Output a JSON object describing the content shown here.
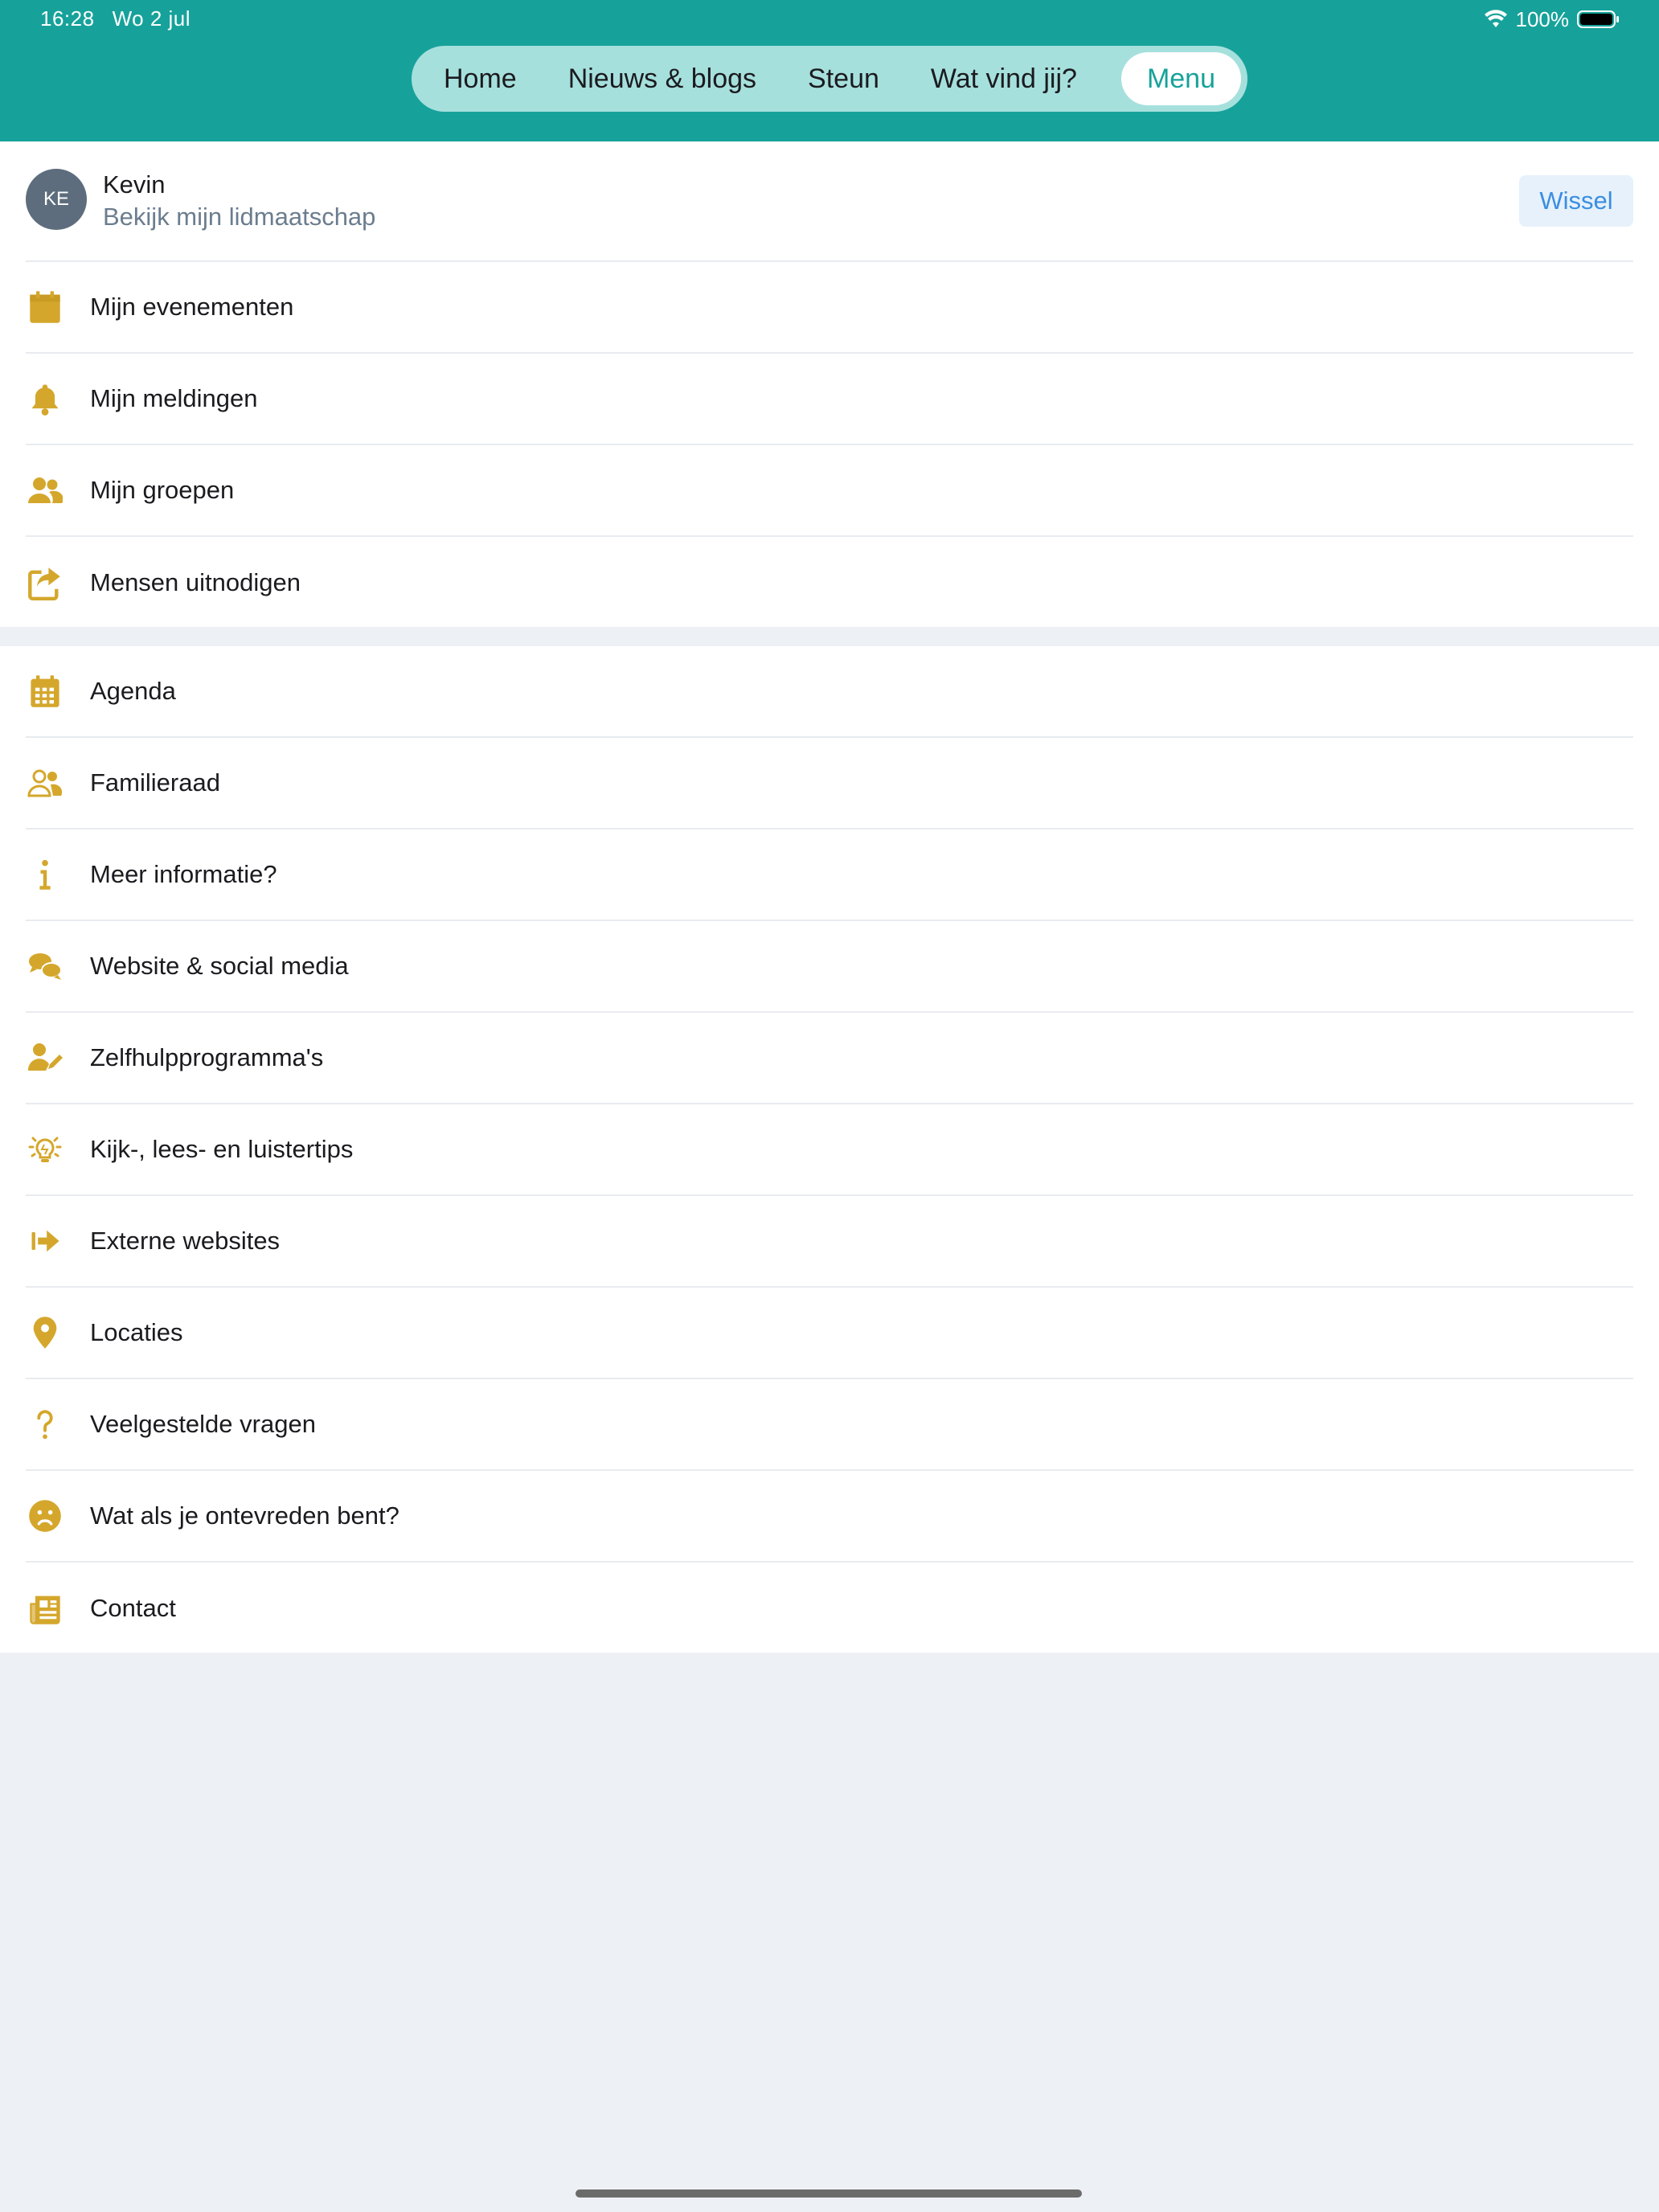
{
  "status_bar": {
    "time": "16:28",
    "date": "Wo 2 jul",
    "battery": "100%"
  },
  "nav": {
    "tabs": [
      {
        "label": "Home"
      },
      {
        "label": "Nieuws & blogs"
      },
      {
        "label": "Steun"
      },
      {
        "label": "Wat vind jij?"
      },
      {
        "label": "Menu"
      }
    ],
    "active": "Menu"
  },
  "profile": {
    "initials": "KE",
    "name": "Kevin",
    "subtitle": "Bekijk mijn lidmaatschap",
    "switch_label": "Wissel"
  },
  "personal_menu": [
    {
      "label": "Mijn evenementen",
      "icon": "calendar-icon"
    },
    {
      "label": "Mijn meldingen",
      "icon": "bell-icon"
    },
    {
      "label": "Mijn groepen",
      "icon": "users-icon"
    },
    {
      "label": "Mensen uitnodigen",
      "icon": "share-icon"
    }
  ],
  "main_menu": [
    {
      "label": "Agenda",
      "icon": "calendar-grid-icon"
    },
    {
      "label": "Familieraad",
      "icon": "user-group-icon"
    },
    {
      "label": "Meer informatie?",
      "icon": "info-icon"
    },
    {
      "label": "Website & social media",
      "icon": "comments-icon"
    },
    {
      "label": "Zelfhulpprogramma's",
      "icon": "user-pen-icon"
    },
    {
      "label": "Kijk-, lees- en luistertips",
      "icon": "lightbulb-icon"
    },
    {
      "label": "Externe websites",
      "icon": "external-arrow-icon"
    },
    {
      "label": "Locaties",
      "icon": "location-pin-icon"
    },
    {
      "label": "Veelgestelde vragen",
      "icon": "question-icon"
    },
    {
      "label": "Wat als je ontevreden bent?",
      "icon": "sad-face-icon"
    },
    {
      "label": "Contact",
      "icon": "newspaper-icon"
    }
  ],
  "colors": {
    "header": "#16a29a",
    "nav_pill": "#a6e0dd",
    "icon": "#d4a72c",
    "switch_text": "#3a8ee0"
  }
}
